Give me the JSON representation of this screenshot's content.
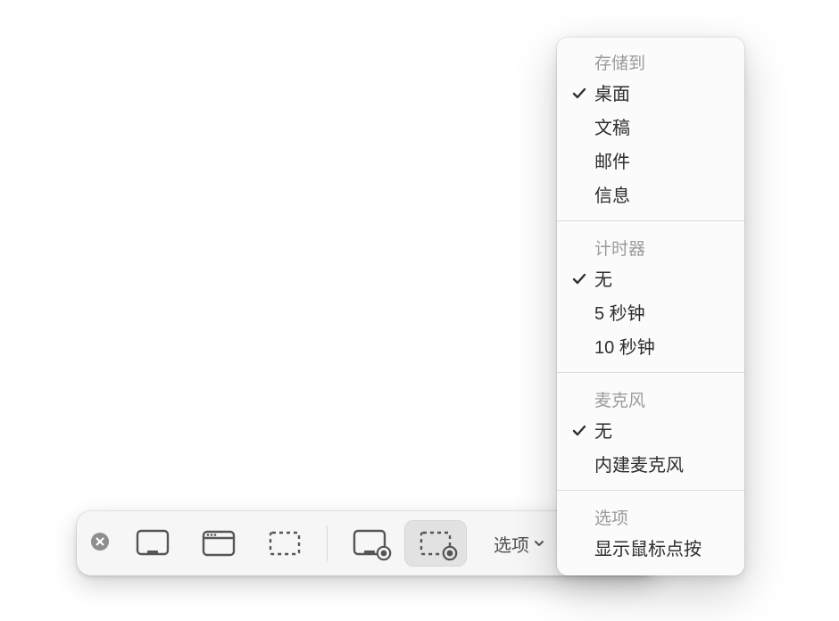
{
  "toolbar": {
    "close_icon": "close",
    "buttons": {
      "capture_fullscreen": "capture-fullscreen",
      "capture_window": "capture-window",
      "capture_selection": "capture-selection",
      "record_fullscreen": "record-fullscreen",
      "record_selection": "record-selection"
    },
    "selected": "record_selection",
    "options_label": "选项"
  },
  "menu": {
    "sections": [
      {
        "header": "存储到",
        "items": [
          {
            "label": "桌面",
            "checked": true
          },
          {
            "label": "文稿",
            "checked": false
          },
          {
            "label": "邮件",
            "checked": false
          },
          {
            "label": "信息",
            "checked": false
          }
        ]
      },
      {
        "header": "计时器",
        "items": [
          {
            "label": "无",
            "checked": true
          },
          {
            "label": "5 秒钟",
            "checked": false
          },
          {
            "label": "10 秒钟",
            "checked": false
          }
        ]
      },
      {
        "header": "麦克风",
        "items": [
          {
            "label": "无",
            "checked": true
          },
          {
            "label": "内建麦克风",
            "checked": false
          }
        ]
      },
      {
        "header": "选项",
        "items": [
          {
            "label": "显示鼠标点按",
            "checked": false
          }
        ]
      }
    ]
  }
}
